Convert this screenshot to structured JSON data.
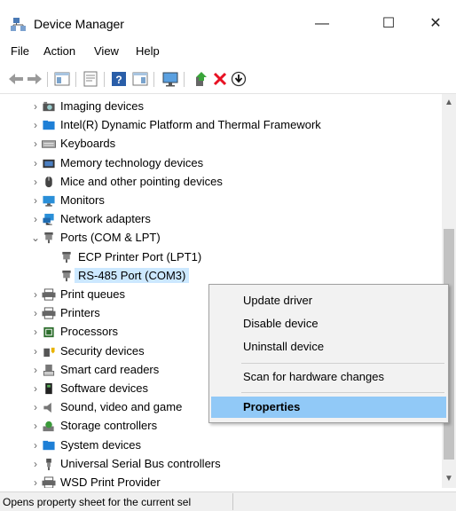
{
  "window": {
    "title": "Device Manager",
    "minimize": "—",
    "maximize": "☐",
    "close": "✕"
  },
  "menu": [
    "File",
    "Action",
    "View",
    "Help"
  ],
  "tree": [
    {
      "label": "Imaging devices",
      "icon": "imaging-icon",
      "expander": "›",
      "level": 1
    },
    {
      "label": "Intel(R) Dynamic Platform and Thermal Framework",
      "icon": "intel-folder-icon",
      "expander": "›",
      "level": 1
    },
    {
      "label": "Keyboards",
      "icon": "keyboard-icon",
      "expander": "›",
      "level": 1
    },
    {
      "label": "Memory technology devices",
      "icon": "memory-icon",
      "expander": "›",
      "level": 1
    },
    {
      "label": "Mice and other pointing devices",
      "icon": "mouse-icon",
      "expander": "›",
      "level": 1
    },
    {
      "label": "Monitors",
      "icon": "monitor-icon",
      "expander": "›",
      "level": 1
    },
    {
      "label": "Network adapters",
      "icon": "network-icon",
      "expander": "›",
      "level": 1
    },
    {
      "label": "Ports (COM & LPT)",
      "icon": "port-icon",
      "expander": "⌄",
      "level": 1
    },
    {
      "label": "ECP Printer Port (LPT1)",
      "icon": "port-icon",
      "expander": "",
      "level": 2
    },
    {
      "label": "RS-485 Port (COM3)",
      "icon": "port-icon",
      "expander": "",
      "level": 2,
      "selected": true
    },
    {
      "label": "Print queues",
      "icon": "printer-icon",
      "expander": "›",
      "level": 1
    },
    {
      "label": "Printers",
      "icon": "printer-icon",
      "expander": "›",
      "level": 1
    },
    {
      "label": "Processors",
      "icon": "processor-icon",
      "expander": "›",
      "level": 1
    },
    {
      "label": "Security devices",
      "icon": "security-icon",
      "expander": "›",
      "level": 1
    },
    {
      "label": "Smart card readers",
      "icon": "smartcard-icon",
      "expander": "›",
      "level": 1
    },
    {
      "label": "Software devices",
      "icon": "software-icon",
      "expander": "›",
      "level": 1
    },
    {
      "label": "Sound, video and game",
      "icon": "sound-icon",
      "expander": "›",
      "level": 1
    },
    {
      "label": "Storage controllers",
      "icon": "storage-icon",
      "expander": "›",
      "level": 1
    },
    {
      "label": "System devices",
      "icon": "system-icon",
      "expander": "›",
      "level": 1
    },
    {
      "label": "Universal Serial Bus controllers",
      "icon": "usb-icon",
      "expander": "›",
      "level": 1
    },
    {
      "label": "WSD Print Provider",
      "icon": "printer-icon",
      "expander": "›",
      "level": 1
    }
  ],
  "context_menu": [
    "Update driver",
    "Disable device",
    "Uninstall device",
    "Scan for hardware changes",
    "Properties"
  ],
  "status": "Opens property sheet for the current sel",
  "colors": {
    "selection": "#cce8ff",
    "menu_highlight": "#91c9f7",
    "error_red": "#e81123"
  }
}
